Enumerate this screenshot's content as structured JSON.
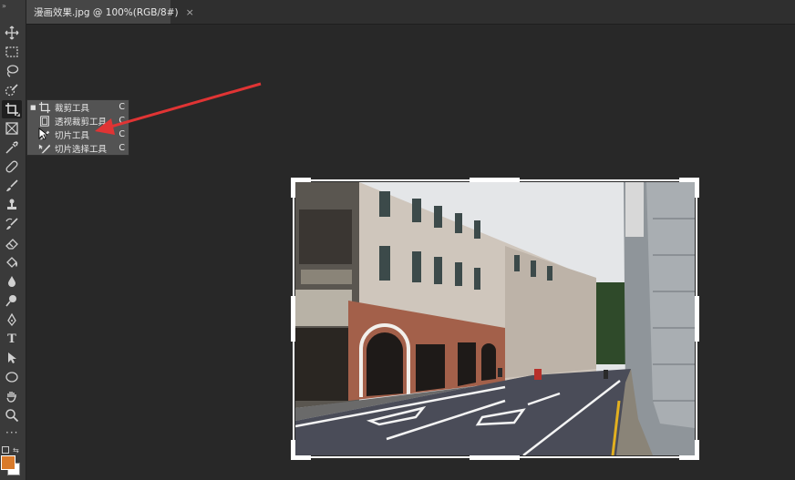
{
  "document": {
    "tab_title": "漫画效果.jpg @ 100%(RGB/8#)",
    "tab_close": "×"
  },
  "toolbar": {
    "collapse": "»",
    "more": "···",
    "type_tool": "T",
    "foreground_color": "#d97a2a",
    "background_color": "#ffffff"
  },
  "flyout": {
    "items": [
      {
        "label": "裁剪工具",
        "shortcut": "C",
        "icon": "crop-icon",
        "selected": true
      },
      {
        "label": "透视裁剪工具",
        "shortcut": "C",
        "icon": "perspective-crop-icon",
        "selected": false
      },
      {
        "label": "切片工具",
        "shortcut": "C",
        "icon": "slice-icon",
        "selected": false
      },
      {
        "label": "切片选择工具",
        "shortcut": "C",
        "icon": "slice-select-icon",
        "selected": false
      }
    ],
    "selected_marker": "■"
  },
  "annotation": {
    "color": "#e03434"
  },
  "accent": "#ffffff"
}
